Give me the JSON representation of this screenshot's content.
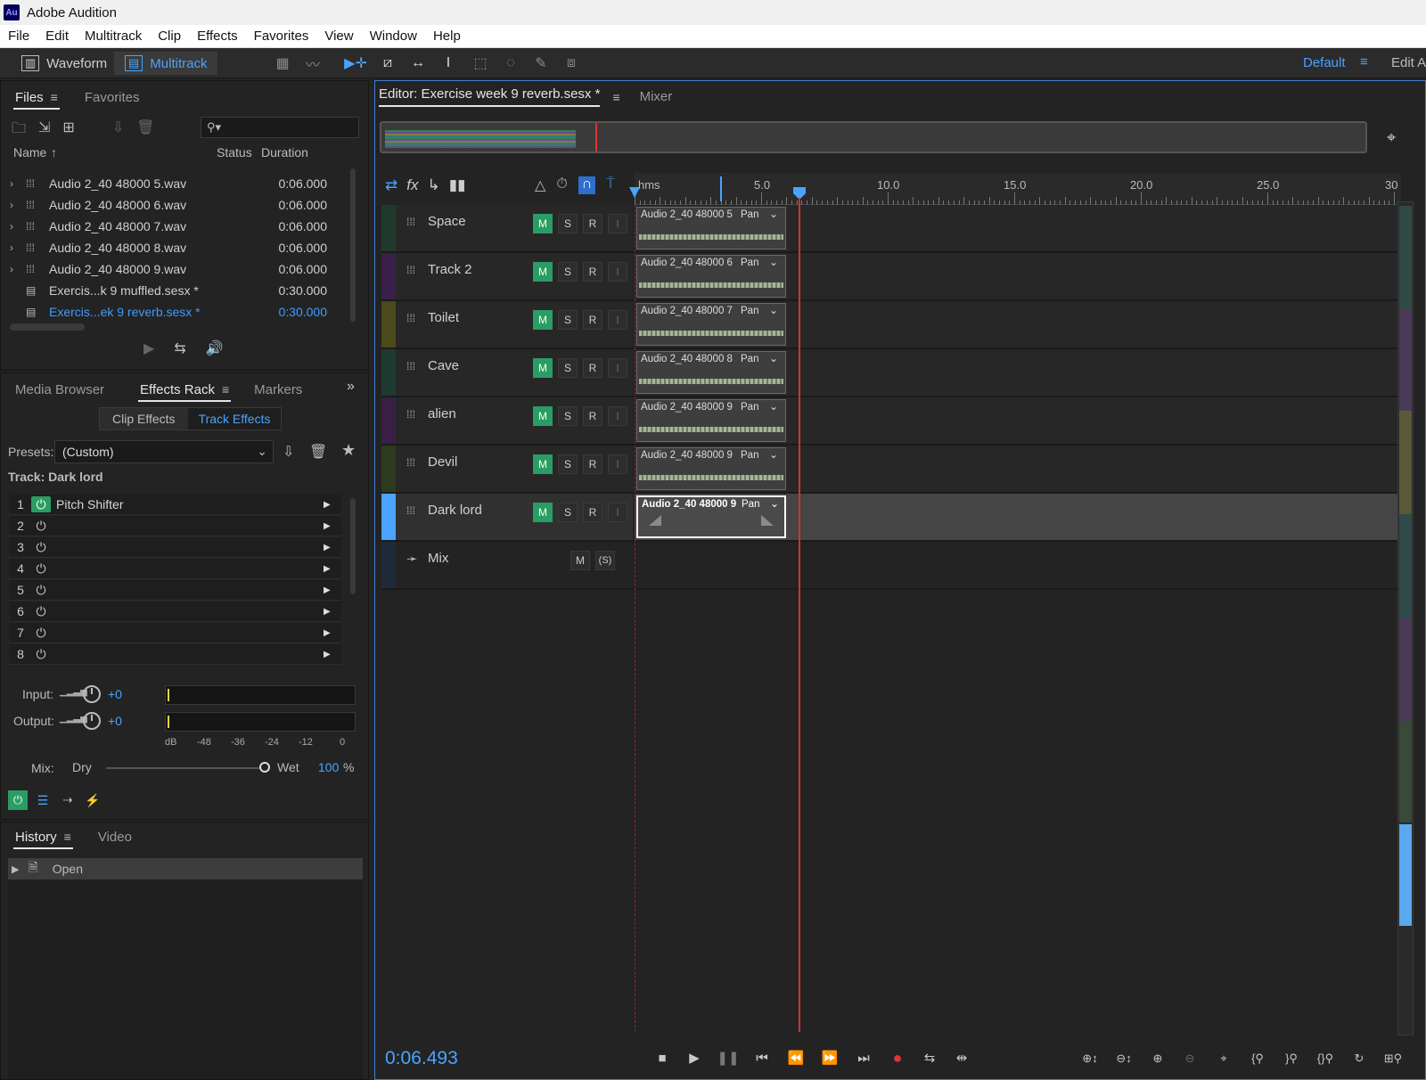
{
  "window": {
    "title": "Adobe Audition",
    "app_icon": "Au"
  },
  "menu": [
    "File",
    "Edit",
    "Multitrack",
    "Clip",
    "Effects",
    "Favorites",
    "View",
    "Window",
    "Help"
  ],
  "toolbar": {
    "waveform_label": "Waveform",
    "multitrack_label": "Multitrack",
    "workspace_label": "Default",
    "edit_label": "Edit Au"
  },
  "files_panel": {
    "tabs": [
      "Files",
      "Favorites"
    ],
    "columns": [
      "Name",
      "Status",
      "Duration"
    ],
    "items": [
      {
        "name": "Audio 2_40 48000 5.wav",
        "duration": "0:06.000"
      },
      {
        "name": "Audio 2_40 48000 6.wav",
        "duration": "0:06.000"
      },
      {
        "name": "Audio 2_40 48000 7.wav",
        "duration": "0:06.000"
      },
      {
        "name": "Audio 2_40 48000 8.wav",
        "duration": "0:06.000"
      },
      {
        "name": "Audio 2_40 48000 9.wav",
        "duration": "0:06.000"
      },
      {
        "name": "Exercis...k 9 muffled.sesx *",
        "duration": "0:30.000"
      },
      {
        "name": "Exercis...ek 9 reverb.sesx *",
        "duration": "0:30.000"
      }
    ]
  },
  "effects_panel": {
    "tabs": [
      "Media Browser",
      "Effects Rack",
      "Markers"
    ],
    "subtabs": [
      "Clip Effects",
      "Track Effects"
    ],
    "presets_label": "Presets:",
    "preset_value": "(Custom)",
    "track_label": "Track: Dark lord",
    "slots": [
      {
        "num": "1",
        "name": "Pitch Shifter"
      },
      {
        "num": "2",
        "name": ""
      },
      {
        "num": "3",
        "name": ""
      },
      {
        "num": "4",
        "name": ""
      },
      {
        "num": "5",
        "name": ""
      },
      {
        "num": "6",
        "name": ""
      },
      {
        "num": "7",
        "name": ""
      },
      {
        "num": "8",
        "name": ""
      }
    ],
    "input_label": "Input:",
    "input_value": "+0",
    "output_label": "Output:",
    "output_value": "+0",
    "meter_scale": [
      "dB",
      "-48",
      "-36",
      "-24",
      "-12",
      "0"
    ],
    "mix_label": "Mix:",
    "dry_label": "Dry",
    "wet_label": "Wet",
    "wet_value": "100",
    "wet_unit": "%"
  },
  "history_panel": {
    "tabs": [
      "History",
      "Video"
    ],
    "items": [
      "Open"
    ]
  },
  "editor": {
    "tab_label": "Editor: Exercise week 9 reverb.sesx *",
    "mixer_label": "Mixer",
    "ruler_unit": "hms",
    "ruler_ticks": [
      "5.0",
      "10.0",
      "15.0",
      "20.0",
      "25.0",
      "30"
    ],
    "tracks": [
      {
        "name": "Space",
        "clip": "Audio 2_40 48000 5",
        "color": "#1f3a2c"
      },
      {
        "name": "Track 2",
        "clip": "Audio 2_40 48000 6",
        "color": "#3a1f4a"
      },
      {
        "name": "Toilet",
        "clip": "Audio 2_40 48000 7",
        "color": "#4a4a1a"
      },
      {
        "name": "Cave",
        "clip": "Audio 2_40 48000 8",
        "color": "#1f3a33"
      },
      {
        "name": "alien",
        "clip": "Audio 2_40 48000 9",
        "color": "#3a1f45"
      },
      {
        "name": "Devil",
        "clip": "Audio 2_40 48000 9",
        "color": "#2d3a1f"
      },
      {
        "name": "Dark lord",
        "clip": "Audio 2_40 48000 9",
        "color": "#4aa3ff"
      }
    ],
    "pan_label": "Pan",
    "mix_track": "Mix",
    "btn_m": "M",
    "btn_s": "S",
    "btn_r": "R",
    "btn_i": "I",
    "btn_s_paren": "(S)",
    "current_time": "0:06.493"
  }
}
